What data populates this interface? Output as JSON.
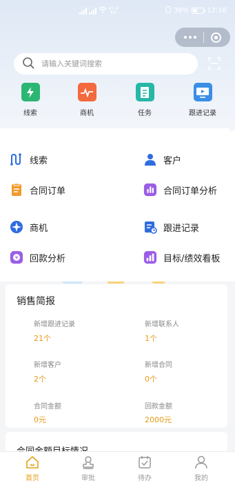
{
  "status_bar": {
    "battery": "38%",
    "time": "12:16",
    "speed_value": "47.4",
    "speed_unit": "K/s"
  },
  "search": {
    "placeholder": "请输入关键词搜索"
  },
  "quick_actions": [
    {
      "label": "线索",
      "icon": "lightning-icon",
      "color": "#2bb673"
    },
    {
      "label": "商机",
      "icon": "pulse-icon",
      "color": "#f26a3d"
    },
    {
      "label": "任务",
      "icon": "task-list-icon",
      "color": "#27b7a8"
    },
    {
      "label": "跟进记录",
      "icon": "monitor-play-icon",
      "color": "#3a8ee6"
    }
  ],
  "menu": [
    {
      "label": "线索",
      "icon": "lead-path-icon"
    },
    {
      "label": "客户",
      "icon": "customer-person-icon"
    },
    {
      "label": "合同订单",
      "icon": "contract-doc-icon"
    },
    {
      "label": "合同订单分析",
      "icon": "contract-chart-icon"
    },
    {
      "label": "商机",
      "icon": "opportunity-compass-icon"
    },
    {
      "label": "跟进记录",
      "icon": "followup-list-icon"
    },
    {
      "label": "回款分析",
      "icon": "payment-yen-icon"
    },
    {
      "label": "目标/绩效看板",
      "icon": "bar-chart-icon"
    }
  ],
  "summary": {
    "title": "销售简报",
    "stats": [
      {
        "label": "新增跟进记录",
        "value": "21个"
      },
      {
        "label": "新增联系人",
        "value": "1个"
      },
      {
        "label": "新增客户",
        "value": "2个"
      },
      {
        "label": "新增合同",
        "value": "0个"
      },
      {
        "label": "合同金额",
        "value": "0元"
      },
      {
        "label": "回款金额",
        "value": "2000元"
      }
    ]
  },
  "next_section_title": "合同金额目标情况",
  "tabbar": [
    {
      "label": "首页",
      "icon": "home-icon",
      "active": true
    },
    {
      "label": "审批",
      "icon": "approval-stamp-icon",
      "active": false
    },
    {
      "label": "待办",
      "icon": "todo-check-icon",
      "active": false
    },
    {
      "label": "我的",
      "icon": "profile-icon",
      "active": false
    }
  ]
}
